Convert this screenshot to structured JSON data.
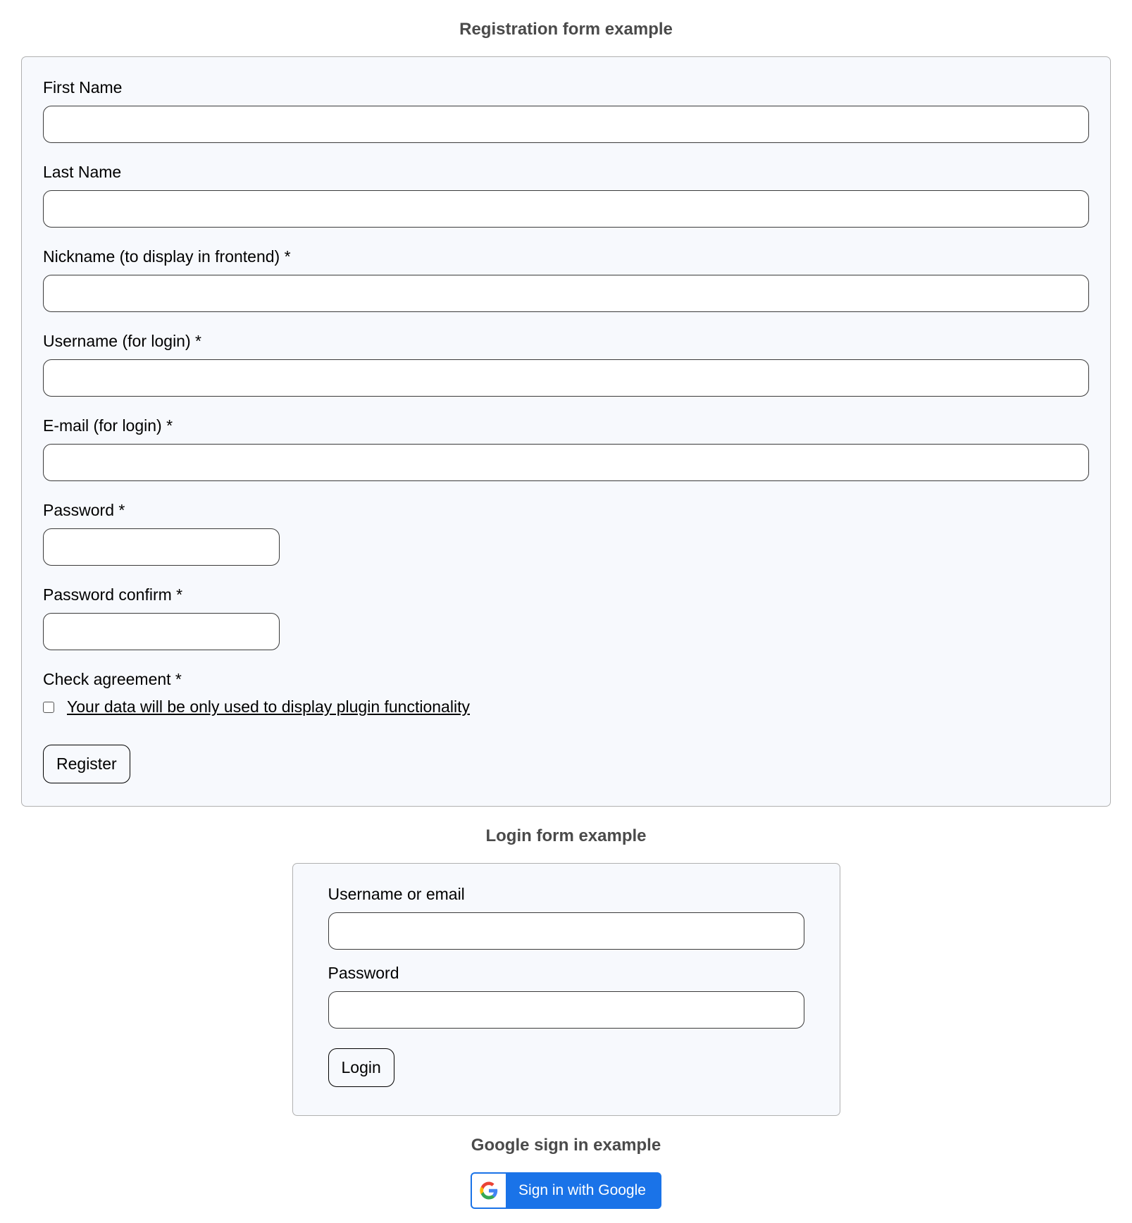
{
  "sections": {
    "registration_heading": "Registration form example",
    "login_heading": "Login form example",
    "google_heading": "Google sign in example"
  },
  "registration": {
    "first_name_label": "First Name",
    "last_name_label": "Last Name",
    "nickname_label": "Nickname (to display in frontend) *",
    "username_label": "Username (for login) *",
    "email_label": "E-mail (for login) *",
    "password_label": "Password *",
    "password_confirm_label": "Password confirm *",
    "agreement_label": "Check agreement *",
    "agreement_text": "Your data will be only used to display plugin functionality",
    "register_button": "Register"
  },
  "login": {
    "username_label": "Username or email",
    "password_label": "Password",
    "login_button": "Login"
  },
  "google": {
    "button_text": "Sign in with Google"
  }
}
